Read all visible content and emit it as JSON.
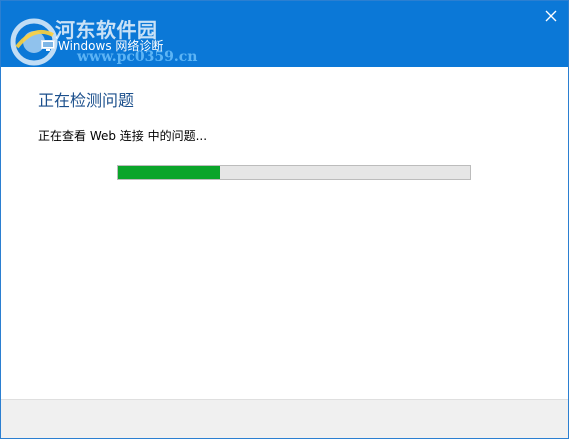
{
  "window": {
    "title": "Windows 网络诊断",
    "title_icon": "network-diagnostics-icon",
    "close_icon": "close-icon"
  },
  "watermark": {
    "site_name": "河东软件园",
    "site_url": "www.pc0359.cn"
  },
  "content": {
    "heading": "正在检测问题",
    "status": "正在查看 Web 连接 中的问题..."
  },
  "progress": {
    "value_percent": 29
  },
  "colors": {
    "titlebar": "#0b78d7",
    "heading": "#1b4f8c",
    "progress_fill": "#0aa52a",
    "progress_track": "#e6e6e6",
    "footer": "#f0f0f0"
  }
}
